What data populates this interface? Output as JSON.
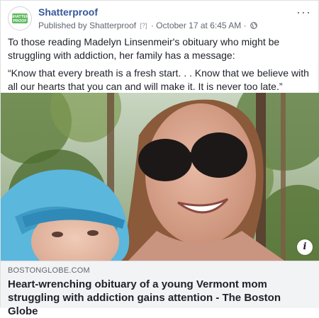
{
  "post": {
    "page_name": "Shatterproof",
    "published_by_prefix": "Published by",
    "publisher": "Shatterproof",
    "badge": "[?]",
    "separator": "·",
    "timestamp": "October 17 at 6:45 AM",
    "more_label": "···",
    "avatar_text_line1": "SHATTER",
    "avatar_text_line2": "PROOF",
    "body_paragraph_1": "To those reading Madelyn Linsenmeir's obituary who might be struggling with addiction, her family has a message:",
    "body_paragraph_2": "“Know that every breath is a fresh start. . . Know that we believe with all our hearts that you can and will make it. It is never too late.”",
    "info_label": "i"
  },
  "link_preview": {
    "domain": "BOSTONGLOBE.COM",
    "headline": "Heart-wrenching obituary of a young Vermont mom struggling with addiction gains attention - The Boston Globe"
  },
  "colors": {
    "link_blue": "#385898",
    "text": "#1d2129",
    "meta": "#616770",
    "preview_bg": "#f2f3f5",
    "logo_green": "#5cb85c"
  }
}
